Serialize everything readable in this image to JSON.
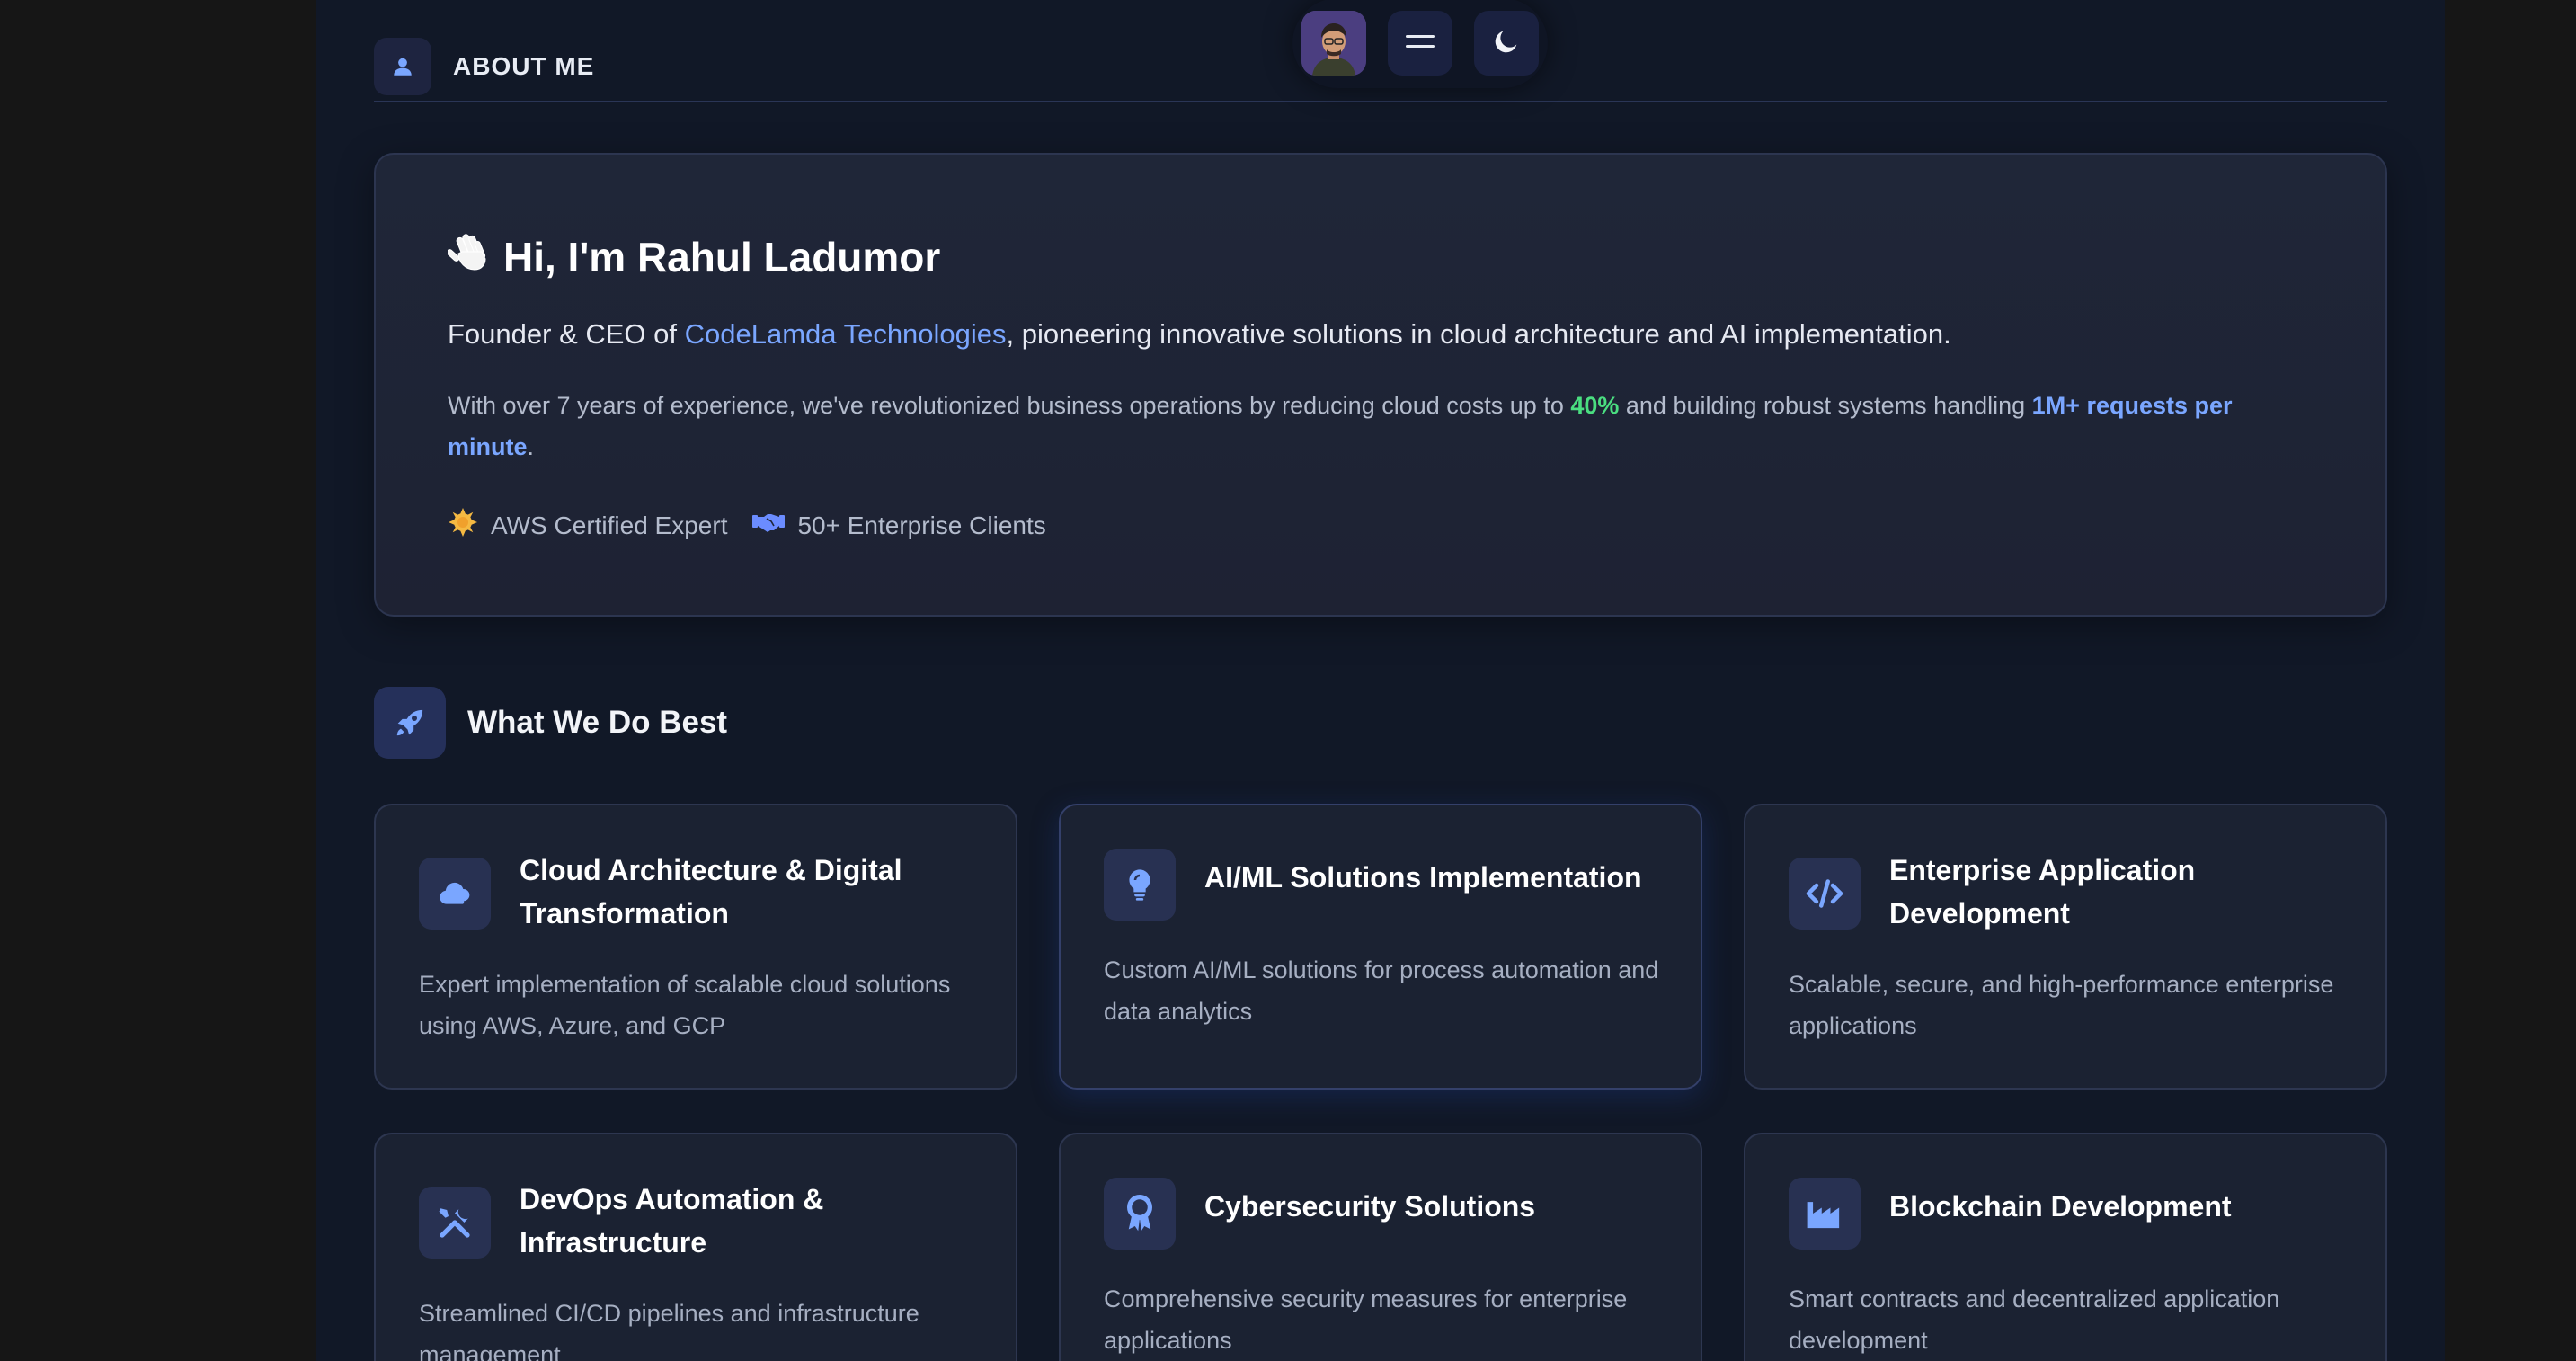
{
  "header": {
    "title": "ABOUT ME",
    "icons": {
      "section": "user-icon",
      "menu": "hamburger-icon",
      "theme": "moon-icon"
    }
  },
  "intro": {
    "greeting": "Hi, I'm Rahul Ladumor",
    "line1_prefix": "Founder & CEO of ",
    "company": "CodeLamda Technologies",
    "line1_suffix": ", pioneering innovative solutions in cloud architecture and AI implementation.",
    "line2_a": "With over 7 years of experience, we've revolutionized business operations by reducing cloud costs up to ",
    "line2_pct": "40%",
    "line2_b": " and building robust systems handling ",
    "line2_req": "1M+ requests per minute",
    "line2_c": ".",
    "badges": [
      {
        "label": "AWS Certified Expert",
        "icon": "sun-badge-icon"
      },
      {
        "label": "50+ Enterprise Clients",
        "icon": "handshake-icon"
      }
    ]
  },
  "section": {
    "title": "What We Do Best",
    "icon": "rocket-icon"
  },
  "services": [
    {
      "title": "Cloud Architecture & Digital Transformation",
      "desc": "Expert implementation of scalable cloud solutions using AWS, Azure, and GCP",
      "icon": "cloud-icon"
    },
    {
      "title": "AI/ML Solutions Implementation",
      "desc": "Custom AI/ML solutions for process automation and data analytics",
      "icon": "lightbulb-icon"
    },
    {
      "title": "Enterprise Application Development",
      "desc": "Scalable, secure, and high-performance enterprise applications",
      "icon": "code-icon"
    },
    {
      "title": "DevOps Automation & Infrastructure",
      "desc": "Streamlined CI/CD pipelines and infrastructure management",
      "icon": "tools-icon"
    },
    {
      "title": "Cybersecurity Solutions",
      "desc": "Comprehensive security measures for enterprise applications",
      "icon": "award-icon"
    },
    {
      "title": "Blockchain Development",
      "desc": "Smart contracts and decentralized application development",
      "icon": "industry-icon"
    }
  ],
  "colors": {
    "accent": "#7aa6ff",
    "green": "#4ade80",
    "background": "#111827",
    "card": "#1b2232"
  }
}
